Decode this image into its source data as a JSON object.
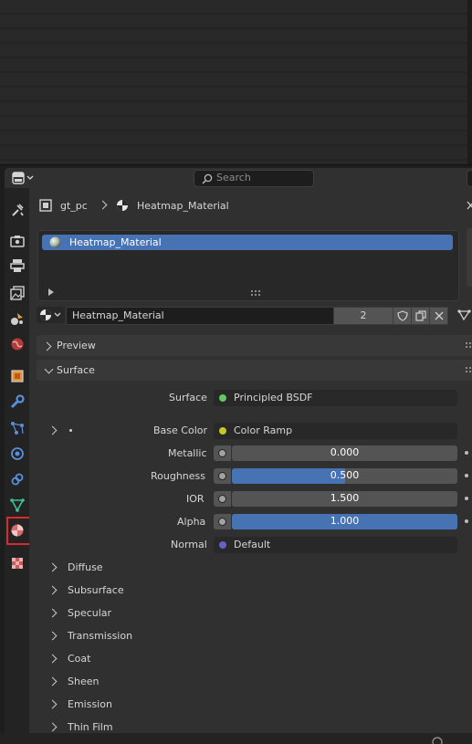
{
  "search": {
    "placeholder": "Search"
  },
  "breadcrumb": {
    "object": "gt_pc",
    "material": "Heatmap_Material"
  },
  "material_slots": [
    {
      "name": "Heatmap_Material"
    }
  ],
  "datablock": {
    "name": "Heatmap_Material",
    "users": "2"
  },
  "panels": {
    "preview": "Preview",
    "surface": "Surface"
  },
  "surface": {
    "surface_label": "Surface",
    "surface_value": "Principled BSDF",
    "base_color_label": "Base Color",
    "base_color_value": "Color Ramp",
    "metallic_label": "Metallic",
    "metallic_value": "0.000",
    "metallic_fraction": 0.0,
    "roughness_label": "Roughness",
    "roughness_value": "0.500",
    "roughness_fraction": 0.5,
    "ior_label": "IOR",
    "ior_value": "1.500",
    "alpha_label": "Alpha",
    "alpha_value": "1.000",
    "alpha_fraction": 1.0,
    "normal_label": "Normal",
    "normal_value": "Default"
  },
  "subpanels": [
    "Diffuse",
    "Subsurface",
    "Specular",
    "Transmission",
    "Coat",
    "Sheen",
    "Emission",
    "Thin Film"
  ],
  "colors": {
    "accent": "#4772b3",
    "shader_socket": "#63c763",
    "color_socket": "#c7c729",
    "vector_socket": "#6363c7",
    "highlight_box": "#d92b2b"
  },
  "tabs": [
    "tool-icon",
    "render-icon",
    "output-icon",
    "view-layer-icon",
    "scene-icon",
    "world-icon",
    "object-icon",
    "modifier-icon",
    "particles-icon",
    "physics-icon",
    "constraints-icon",
    "data-icon",
    "material-icon",
    "texture-icon"
  ]
}
